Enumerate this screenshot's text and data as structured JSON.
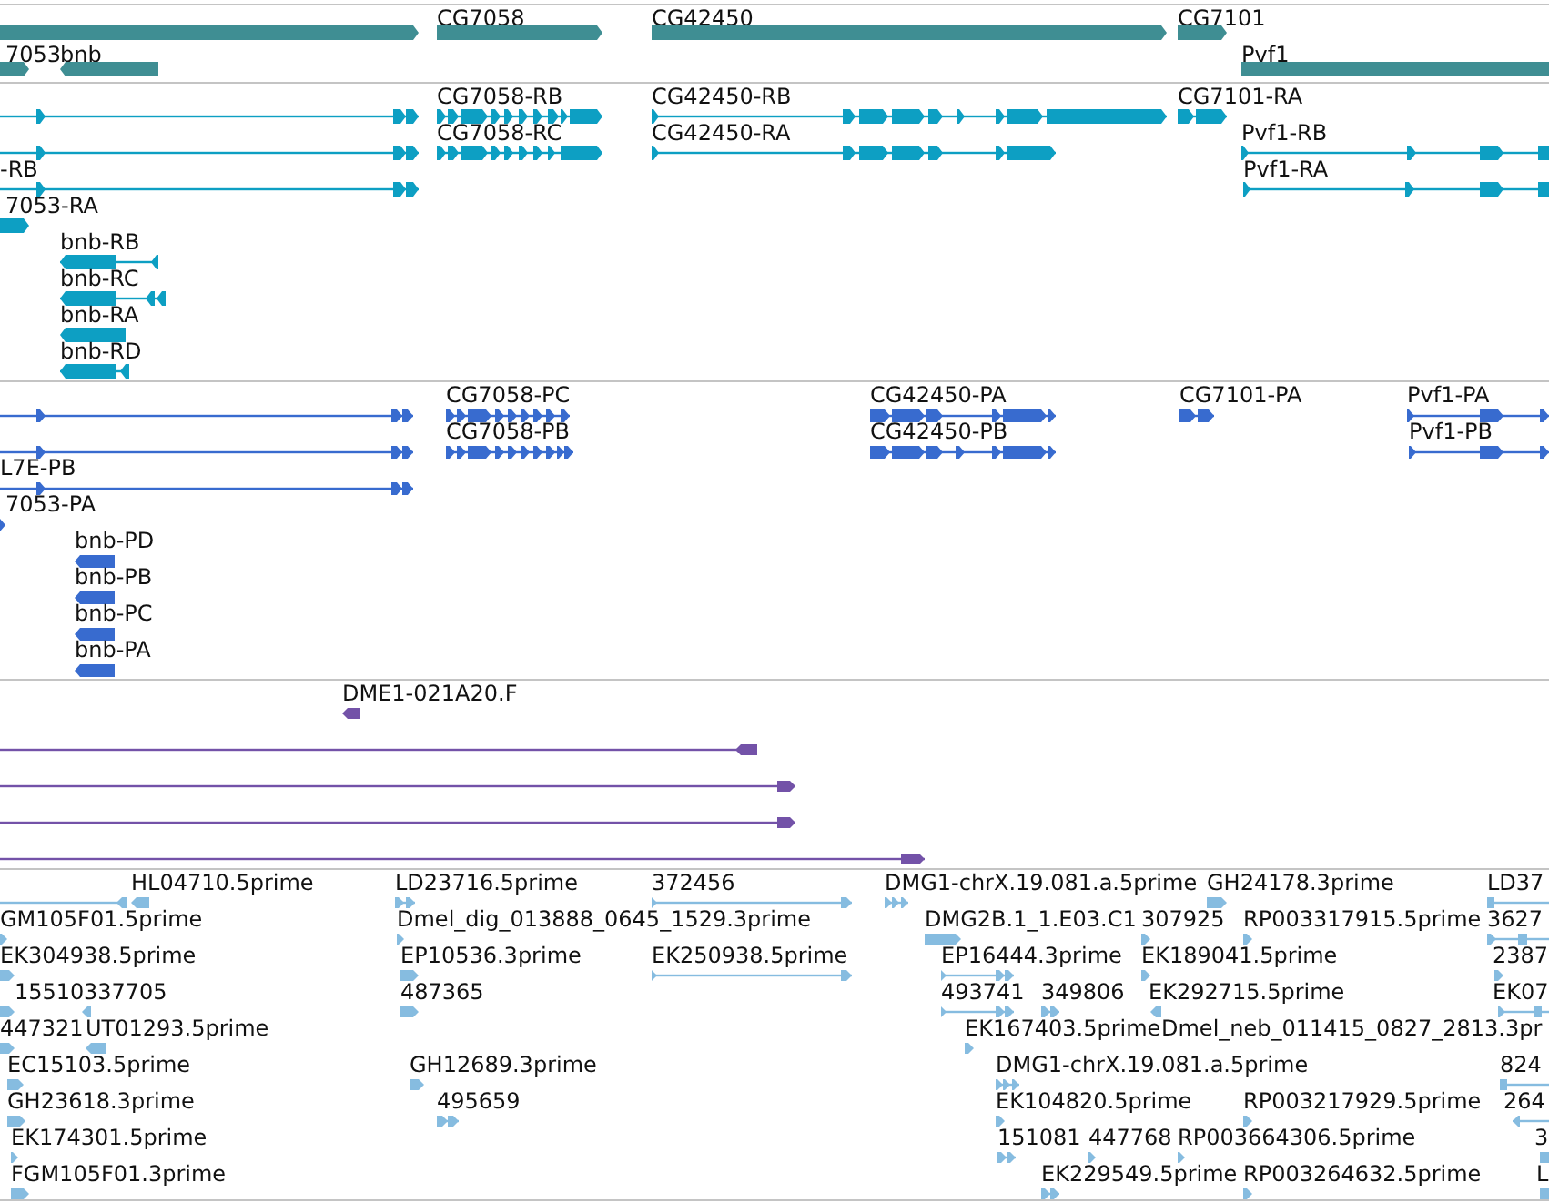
{
  "tracks": [
    {
      "color": "#3f8e93",
      "features": [
        {
          "reverse": false
        },
        {
          "label": "CG7058",
          "reverse": false
        },
        {
          "label": "CG42450",
          "reverse": false
        },
        {
          "label": "CG7101",
          "reverse": false
        },
        {
          "label": "7053",
          "reverse": false
        },
        {
          "label": "bnb",
          "reverse": true
        },
        {
          "label": "Pvf1",
          "reverse": false
        }
      ]
    },
    {
      "color": "#0d9fc3",
      "features": [
        {
          "reverse": false
        },
        {
          "label": "CG7058-RB",
          "reverse": false
        },
        {
          "label": "CG42450-RB",
          "reverse": false
        },
        {
          "label": "CG7101-RA",
          "reverse": false
        },
        {
          "reverse": false
        },
        {
          "label": "CG7058-RC",
          "reverse": false
        },
        {
          "label": "CG42450-RA",
          "reverse": false
        },
        {
          "label": "Pvf1-RB",
          "reverse": false
        },
        {
          "label": "-RB",
          "reverse": false
        },
        {
          "label": "Pvf1-RA",
          "reverse": false
        },
        {
          "label": "7053-RA",
          "reverse": false
        },
        {
          "label": "bnb-RB",
          "reverse": true
        },
        {
          "label": "bnb-RC",
          "reverse": true
        },
        {
          "label": "bnb-RA",
          "reverse": true
        },
        {
          "label": "bnb-RD",
          "reverse": true
        }
      ]
    },
    {
      "color": "#386bcf",
      "features": [
        {
          "reverse": false
        },
        {
          "label": "CG7058-PC",
          "reverse": false
        },
        {
          "label": "CG42450-PA",
          "reverse": false
        },
        {
          "label": "CG7101-PA",
          "reverse": false
        },
        {
          "label": "Pvf1-PA",
          "reverse": false
        },
        {
          "reverse": false
        },
        {
          "label": "CG7058-PB",
          "reverse": false
        },
        {
          "label": "CG42450-PB",
          "reverse": false
        },
        {
          "label": "Pvf1-PB",
          "reverse": false
        },
        {
          "label": "L7E-PB",
          "reverse": false
        },
        {
          "label": "7053-PA",
          "reverse": false
        },
        {
          "label": "bnb-PD",
          "reverse": true
        },
        {
          "label": "bnb-PB",
          "reverse": true
        },
        {
          "label": "bnb-PC",
          "reverse": true
        },
        {
          "label": "bnb-PA",
          "reverse": true
        }
      ]
    },
    {
      "color": "#7352a8",
      "features": [
        {
          "label": "DME1-021A20.F",
          "reverse": true
        },
        {
          "reverse": true
        },
        {
          "reverse": false
        },
        {
          "reverse": false
        },
        {
          "reverse": false
        }
      ]
    },
    {
      "color": "#86bce0",
      "features": [
        {
          "reverse": true
        },
        {
          "label": "HL04710.5prime",
          "reverse": true
        },
        {
          "label": "LD23716.5prime",
          "reverse": false
        },
        {
          "label": "372456",
          "reverse": false
        },
        {
          "label": "DMG1-chrX.19.081.a.5prime",
          "reverse": false
        },
        {
          "label": "GH24178.3prime",
          "reverse": false
        },
        {
          "label": "LD37",
          "reverse": false
        },
        {
          "label": "GM105F01.5prime",
          "reverse": false
        },
        {
          "label": "Dmel_dig_013888_0645_1529.3prime",
          "reverse": false
        },
        {
          "label": "DMG2B.1_1.E03.C1",
          "reverse": false
        },
        {
          "label": "307925",
          "reverse": false
        },
        {
          "label": "RP003317915.5prime",
          "reverse": false
        },
        {
          "label": "3627",
          "reverse": false
        },
        {
          "label": "EK304938.5prime",
          "reverse": false
        },
        {
          "label": "EP10536.3prime",
          "reverse": false
        },
        {
          "label": "EK250938.5prime",
          "reverse": false
        },
        {
          "label": "EP16444.3prime",
          "reverse": false
        },
        {
          "label": "EK189041.5prime",
          "reverse": false
        },
        {
          "label": "2387",
          "reverse": false
        },
        {
          "label": "15510",
          "reverse": false
        },
        {
          "label": "337705",
          "reverse": true
        },
        {
          "label": "487365",
          "reverse": false
        },
        {
          "label": "493741",
          "reverse": false
        },
        {
          "label": "349806",
          "reverse": false
        },
        {
          "label": "EK292715.5prime",
          "reverse": true
        },
        {
          "label": "EK07",
          "reverse": false
        },
        {
          "label": "447321",
          "reverse": false
        },
        {
          "label": "UT01293.5prime",
          "reverse": true
        },
        {
          "label": "EK167403.5prime",
          "reverse": false
        },
        {
          "label": "Dmel_neb_011415_0827_2813.3pr"
        },
        {
          "label": "EC15103.5prime",
          "reverse": false
        },
        {
          "label": "GH12689.3prime",
          "reverse": false
        },
        {
          "label": "DMG1-chrX.19.081.a.5prime",
          "reverse": false
        },
        {
          "label": "824",
          "reverse": false
        },
        {
          "label": "GH23618.3prime",
          "reverse": false
        },
        {
          "label": "495659",
          "reverse": false
        },
        {
          "label": "EK104820.5prime",
          "reverse": false
        },
        {
          "label": "RP003217929.5prime",
          "reverse": false
        },
        {
          "label": "264",
          "reverse": true
        },
        {
          "label": "EK174301.5prime",
          "reverse": false
        },
        {
          "label": "151081",
          "reverse": false
        },
        {
          "label": "447768",
          "reverse": false
        },
        {
          "label": "RP003664306.5prime",
          "reverse": false
        },
        {
          "label": "3",
          "reverse": false
        },
        {
          "label": "FGM105F01.3prime",
          "reverse": false
        },
        {
          "label": "EK229549.5prime",
          "reverse": false
        },
        {
          "label": "RP003264632.5prime",
          "reverse": false
        },
        {
          "label": "L",
          "reverse": false
        }
      ]
    }
  ]
}
